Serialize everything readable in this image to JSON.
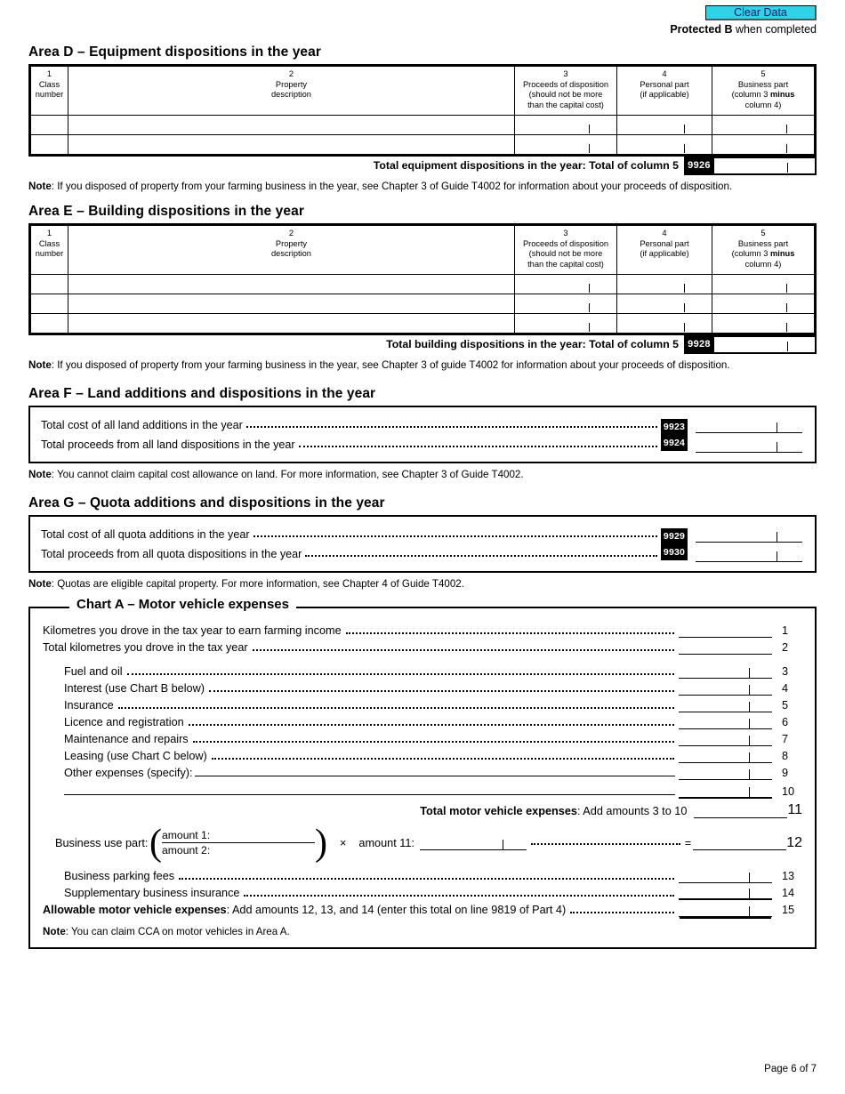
{
  "header": {
    "clear_data_label": "Clear Data",
    "protected_bold": "Protected B",
    "protected_rest": " when completed",
    "clear_data_bg": "#2ed4e6",
    "clear_data_fg": "#1a1a6e"
  },
  "area_d": {
    "heading": "Area D – Equipment dispositions in the year",
    "columns": [
      {
        "num": "1",
        "label": "Class\nnumber"
      },
      {
        "num": "2",
        "label": "Property\ndescription"
      },
      {
        "num": "3",
        "label": "Proceeds of disposition\n(should not be more\nthan the capital cost)"
      },
      {
        "num": "4",
        "label": "Personal part\n(if applicable)"
      },
      {
        "num": "5",
        "label": "Business part\n(column 3 minus\ncolumn 4)"
      }
    ],
    "col1_num": "1",
    "col1_l1": "Class",
    "col1_l2": "number",
    "col2_num": "2",
    "col2_l1": "Property",
    "col2_l2": "description",
    "col3_num": "3",
    "col3_l1": "Proceeds of disposition",
    "col3_l2": "(should not be more",
    "col3_l3": "than the capital cost)",
    "col4_num": "4",
    "col4_l1": "Personal part",
    "col4_l2": "(if applicable)",
    "col5_num": "5",
    "col5_l1": "Business part",
    "col5_l2a": "(column 3 ",
    "col5_l2b": "minus",
    "col5_l3": "column 4)",
    "rows": 2,
    "total_label": "Total equipment dispositions in the year: Total of column 5",
    "total_code": "9926",
    "note_bold": "Note",
    "note_text": ": If you disposed of property from your farming business in the year, see Chapter 3 of Guide T4002 for information about your proceeds of disposition."
  },
  "area_e": {
    "heading": "Area E – Building dispositions in the year",
    "col1_num": "1",
    "col1_l1": "Class",
    "col1_l2": "number",
    "col2_num": "2",
    "col2_l1": "Property",
    "col2_l2": "description",
    "col3_num": "3",
    "col3_l1": "Proceeds of disposition",
    "col3_l2": "(should not be more",
    "col3_l3": "than the capital cost)",
    "col4_num": "4",
    "col4_l1": "Personal part",
    "col4_l2": "(if applicable)",
    "col5_num": "5",
    "col5_l1": "Business part",
    "col5_l2a": "(column 3 ",
    "col5_l2b": "minus",
    "col5_l3": "column 4)",
    "rows": 3,
    "total_label": "Total building dispositions in the year: Total of column 5",
    "total_code": "9928",
    "note_bold": "Note",
    "note_text": ": If you disposed of property from your farming business in the year, see Chapter 3 of guide T4002 for information about your proceeds of disposition."
  },
  "area_f": {
    "heading": "Area F – Land additions and dispositions in the year",
    "line1_label": "Total cost of all land additions in the year",
    "line1_code": "9923",
    "line2_label": "Total proceeds from all land dispositions in the year",
    "line2_code": "9924",
    "note_bold": "Note",
    "note_text": ": You cannot claim capital cost allowance on land. For more information, see Chapter 3 of Guide T4002."
  },
  "area_g": {
    "heading": "Area G – Quota additions and dispositions in the year",
    "line1_label": "Total cost of all quota additions in the year",
    "line1_code": "9929",
    "line2_label": "Total proceeds from all quota dispositions in the year",
    "line2_code": "9930",
    "note_bold": "Note",
    "note_text": ": Quotas are eligible capital property. For more information, see Chapter 4 of Guide T4002."
  },
  "chart_a": {
    "title": "Chart A – Motor vehicle expenses",
    "line1_label": "Kilometres you drove in the tax year to earn farming income",
    "line1_no": "1",
    "line2_label": "Total kilometres you drove in the tax year",
    "line2_no": "2",
    "line3_label": "Fuel and oil",
    "line3_no": "3",
    "line4_label": "Interest (use Chart B below)",
    "line4_no": "4",
    "line5_label": "Insurance",
    "line5_no": "5",
    "line6_label": "Licence and registration",
    "line6_no": "6",
    "line7_label": "Maintenance and repairs",
    "line7_no": "7",
    "line8_label": "Leasing (use Chart C below)",
    "line8_no": "8",
    "line9_label": "Other expenses (specify):",
    "line9_no": "9",
    "line10_no": "10",
    "total_bold": "Total motor vehicle expenses",
    "total_rest": ": Add amounts 3 to 10",
    "total_no": "11",
    "business_use_label": "Business use part:",
    "amount1_label": "amount 1:",
    "amount2_label": "amount 2:",
    "times_symbol": "×",
    "amount11_label": "amount 11:",
    "equals_symbol": "=",
    "line12_no": "12",
    "line13_label": "Business parking fees",
    "line13_no": "13",
    "line14_label": "Supplementary business insurance",
    "line14_no": "14",
    "line15_bold": "Allowable motor vehicle expenses",
    "line15_rest": ": Add amounts 12, 13, and 14 (enter this total on line 9819 of Part 4)",
    "line15_no": "15",
    "note_bold": "Note",
    "note_text": ": You can claim CCA on motor vehicles in Area A."
  },
  "footer": {
    "page_label": "Page 6 of 7"
  }
}
